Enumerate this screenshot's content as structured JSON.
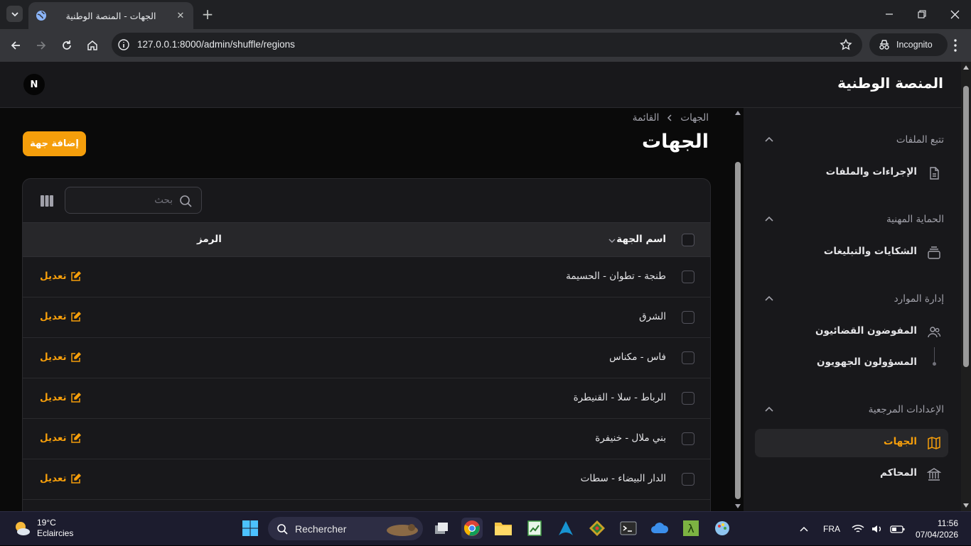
{
  "browser": {
    "tab_title": "الجهات - المنصة الوطنية",
    "url": "127.0.0.1:8000/admin/shuffle/regions",
    "incognito_label": "Incognito"
  },
  "app": {
    "brand": "المنصة الوطنية",
    "avatar_initial": "N",
    "accent": "#f59e0b"
  },
  "sidebar": {
    "groups": [
      {
        "label": "تتبع الملفات",
        "items": [
          {
            "label": "الإجراءات والملفات",
            "icon": "document-icon"
          }
        ]
      },
      {
        "label": "الحماية المهنية",
        "items": [
          {
            "label": "الشكايات والتبليغات",
            "icon": "inbox-stack-icon"
          }
        ]
      },
      {
        "label": "إدارة الموارد",
        "items": [
          {
            "label": "المفوضون القضائيون",
            "icon": "users-icon"
          },
          {
            "label": "المسؤولون الجهويون",
            "icon": "sub-item-dot"
          }
        ]
      },
      {
        "label": "الإعدادات المرجعية",
        "items": [
          {
            "label": "الجهات",
            "icon": "map-icon",
            "active": true
          },
          {
            "label": "المحاكم",
            "icon": "building-library-icon"
          }
        ]
      }
    ]
  },
  "main": {
    "breadcrumb": {
      "root": "الجهات",
      "current": "القائمة"
    },
    "title": "الجهات",
    "add_button": "إضافة جهة",
    "search_placeholder": "بحث",
    "columns": {
      "name": "اسم الجهة",
      "code": "الرمز"
    },
    "edit_label": "تعديل",
    "rows": [
      {
        "name": "طنجة - تطوان - الحسيمة"
      },
      {
        "name": "الشرق"
      },
      {
        "name": "فاس - مكناس"
      },
      {
        "name": "الرباط - سلا - القنيطرة"
      },
      {
        "name": "بني ملال - خنيفرة"
      },
      {
        "name": "الدار البيضاء - سطات"
      }
    ]
  },
  "taskbar": {
    "weather_temp": "19°C",
    "weather_desc": "Eclaircies",
    "search_label": "Rechercher",
    "language": "FRA",
    "time": "11:56",
    "date": "07/04/2026"
  }
}
